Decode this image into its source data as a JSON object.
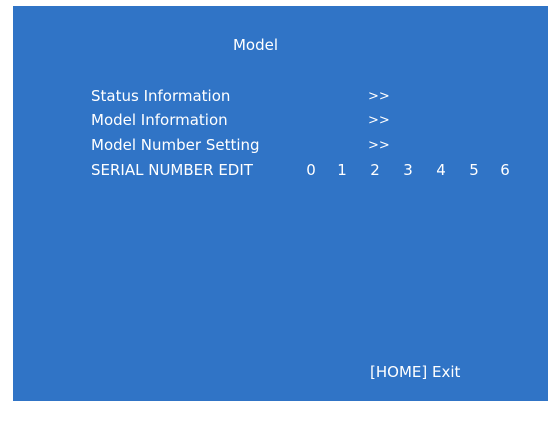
{
  "screen": {
    "title": "Model"
  },
  "menu": {
    "items": [
      {
        "label": "Status Information",
        "arrow": ">>"
      },
      {
        "label": "Model Information",
        "arrow": ">>"
      },
      {
        "label": "Model Number Setting",
        "arrow": ">>"
      }
    ],
    "serial_edit": {
      "label": "SERIAL NUMBER EDIT",
      "digits": [
        "0",
        "1",
        "2",
        "3",
        "4",
        "5",
        "6"
      ]
    }
  },
  "footer": {
    "exit_label": "[HOME] Exit"
  },
  "colors": {
    "background": "#3074c6",
    "text": "#ffffff"
  }
}
